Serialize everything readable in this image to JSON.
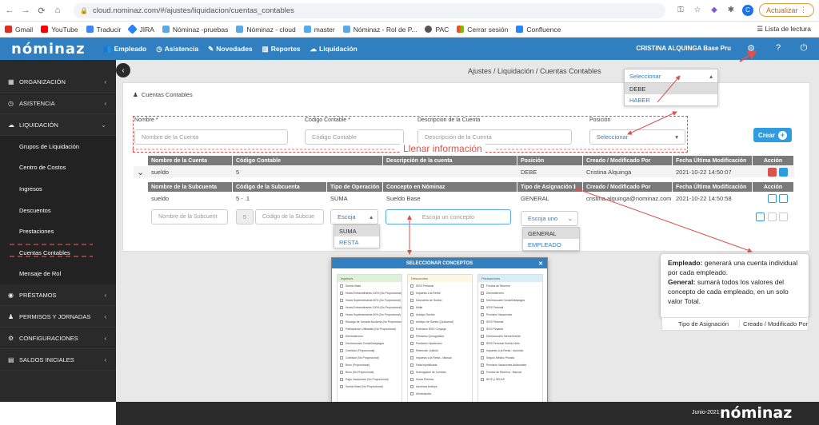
{
  "browser": {
    "url": "cloud.nominaz.com/#/ajustes/liquidacion/cuentas_contables",
    "avatar_letter": "C",
    "update_label": "Actualizar",
    "bookmarks": [
      "Gmail",
      "YouTube",
      "Traducir",
      "JIRA",
      "Nóminaz -pruebas",
      "Nóminaz - cloud",
      "master",
      "Nóminaz - Rol de P...",
      "PAC",
      "Cerrar sesión",
      "Confluence"
    ],
    "reading_list": "Lista de lectura"
  },
  "topbar": {
    "logo": "nóminaz",
    "nav": [
      "Empleado",
      "Asistencia",
      "Novedades",
      "Reportes",
      "Liquidación"
    ],
    "user": "CRISTINA ALQUINGA Base Pru"
  },
  "sidebar": {
    "items": [
      {
        "label": "ORGANIZACIÓN",
        "chev": "‹"
      },
      {
        "label": "ASISTENCIA",
        "chev": "‹"
      },
      {
        "label": "LIQUIDACIÓN",
        "chev": "⌄"
      }
    ],
    "sub_items": [
      "Grupos de Liquidación",
      "Centro de Costos",
      "Ingresos",
      "Descuentos",
      "Prestaciones",
      "Cuentas Contables",
      "Mensaje de Rol"
    ],
    "bottom_items": [
      {
        "label": "PRÉSTAMOS",
        "chev": "‹"
      },
      {
        "label": "PERMISOS Y JORNADAS",
        "chev": "‹"
      },
      {
        "label": "CONFIGURACIONES",
        "chev": "‹"
      },
      {
        "label": "SALDOS INICIALES",
        "chev": "‹"
      }
    ]
  },
  "breadcrumb": "Ajustes / Liquidación / Cuentas Contables",
  "panel": {
    "title": "Cuentas Contables",
    "form": {
      "nombre_label": "Nombre *",
      "nombre_placeholder": "Nombre de la Cuenta",
      "codigo_label": "Codigo Contable *",
      "codigo_placeholder": "Código Contable",
      "descripcion_label": "Descripcion de la Cuenta",
      "descripcion_placeholder": "Descripción de la Cuenta",
      "posicion_label": "Posición",
      "posicion_value": "Seleccionar"
    },
    "crear_label": "Crear",
    "annotation": "Llenar información"
  },
  "posicion_dropdown": {
    "head": "Seleccionar",
    "options": [
      "DEBE",
      "HABER"
    ]
  },
  "main_table": {
    "headers": [
      "Nombre de la Cuenta",
      "Código Contable",
      "Descripción de la cuenta",
      "Posición",
      "Creado / Modificado Por",
      "Fecha Última Modificación",
      "Acción"
    ],
    "row": [
      "sueldo",
      "5",
      "",
      "DEBE",
      "Cristina Alquinga",
      "2021-10-22 14:50:07"
    ]
  },
  "sub_table": {
    "headers": [
      "Nombre de la Subcuenta",
      "Código de la Subcuenta",
      "Tipo de Operación",
      "Concepto en Nóminaz",
      "Tipo de Asignación",
      "Creado / Modificado Por",
      "Fecha Última Modificación",
      "Acción"
    ],
    "row": [
      "sueldo",
      "5 - .1",
      "SUMA",
      "Sueldo Base",
      "GENERAL",
      "cristina.alquinga@nominaz.com",
      "2021-10-22 14:50:58"
    ],
    "new_row": {
      "nombre_placeholder": "Nombre de la Subcuent",
      "prefix": "5",
      "codigo_placeholder": "Código de la Subcue",
      "operacion_value": "Escoja",
      "concepto_placeholder": "Escoja un concepto",
      "asignacion_value": "Escoja uno"
    }
  },
  "operacion_dropdown": {
    "options": [
      "SUMA",
      "RESTA"
    ]
  },
  "asignacion_dropdown": {
    "options": [
      "GENERAL",
      "EMPLEADO"
    ]
  },
  "modal": {
    "title": "SELECCIONAR CONCEPTOS",
    "columns": [
      {
        "title": "Ingresos",
        "color": "#dff0d8",
        "items": [
          "Sueldo Base",
          "Horas Extraordinarias 100% (No Proporcional)",
          "Horas Suplementarias 50% (No Proporcional)",
          "Horas Extraordinarias 100% (No Proporcional)",
          "Horas Suplementarias 50% (No Proporcional)",
          "Recargo de Jornada Nocturna (No Proporcional)",
          "Participación Utilidades (No Proporcional)",
          "Decimotercero",
          "Decimocuarto Costa/Galápagos",
          "Comisión (Proporcional)",
          "Comisión (No Proporcional)",
          "Bono (Proporcional)",
          "Bono (No Proporcional)",
          "Pago Vacaciones (No Proporcional)",
          "Sueldo Base (No Proporcional)"
        ]
      },
      {
        "title": "Descuentos",
        "color": "#fcf8e3",
        "items": [
          "IESS Personal",
          "Impuesto a la Renta",
          "Descuento de Sueldo",
          "Multa",
          "Anticipo Sueldo",
          "Anticipo de Sueldo (Quincenal)",
          "Extensión IESS Cónyuge",
          "Préstamo Quirografario",
          "Préstamo Hipotecario",
          "Retención Judicial",
          "Impuesto a la Renta - Manual",
          "Falta Injustificada",
          "Subrogación de Contrato",
          "Horas Permiso",
          "Ausencia Anticipo",
          "Alimentación"
        ]
      },
      {
        "title": "Prestaciones",
        "color": "#d9edf7",
        "items": [
          "Fondos de Reserva",
          "Décimotercero",
          "Décimocuarto Costa/Galápagos",
          "IESS Patronal",
          "Provisión Vacaciones",
          "IESS Patronal",
          "IESS Pasante",
          "Décimocuarto Sierra/Oriente",
          "IESS Personal Sueldo Neto",
          "Impuesto a la Renta - Asumido",
          "Seguro Médico Privado",
          "Provisión Vacaciones Adicionales",
          "Fondos de Reserva - Manual",
          "IECE y SECAP"
        ]
      }
    ],
    "accept_label": "Aceptar ✓"
  },
  "tooltip": {
    "empleado_title": "Empleado:",
    "empleado_text": "generará una cuenta individual por cada empleado.",
    "general_title": "General:",
    "general_text": "sumará todos los valores del concepto de cada empleado, en un solo valor Total.",
    "tbl_col1": "Tipo de Asignación",
    "tbl_col2": "Creado / Modificado Por"
  },
  "footer": {
    "year": "Junio-2021",
    "logo": "nóminaz"
  },
  "colors": {
    "brand": "#2f7fc1",
    "sidebar": "#2a2a2a",
    "annotation": "#d9534f",
    "action_blue": "#2f9be0"
  }
}
